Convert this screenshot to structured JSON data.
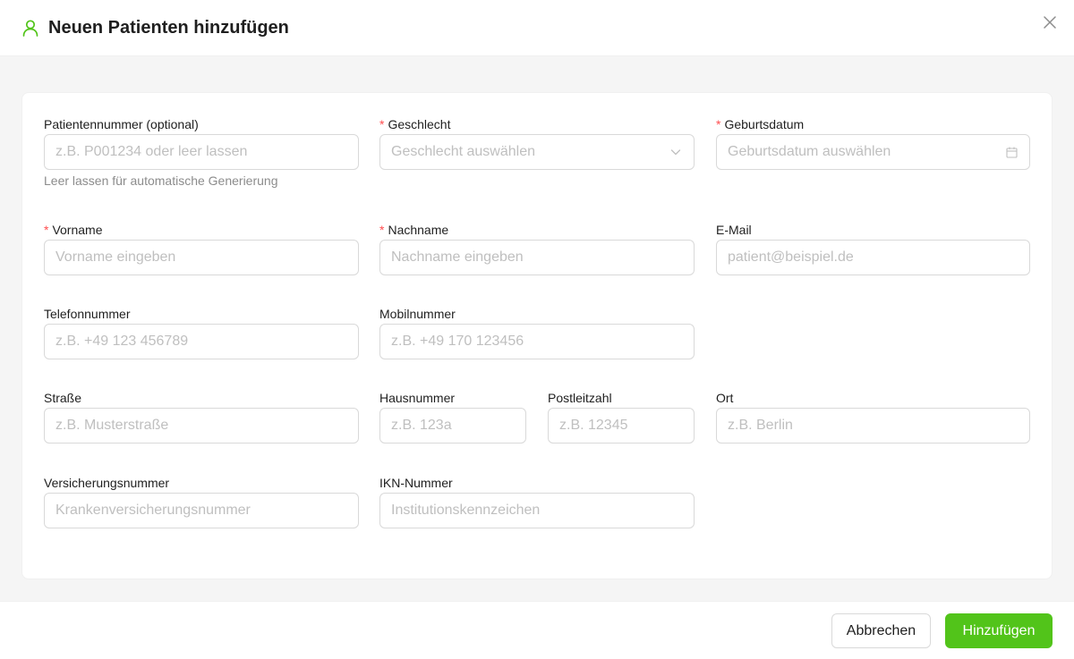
{
  "header": {
    "title": "Neuen Patienten hinzufügen",
    "icon": "user-icon",
    "accent_color": "#52c41a"
  },
  "form": {
    "patient_number": {
      "label": "Patientennummer (optional)",
      "placeholder": "z.B. P001234 oder leer lassen",
      "help": "Leer lassen für automatische Generierung"
    },
    "gender": {
      "label": "Geschlecht",
      "required": "*",
      "placeholder": "Geschlecht auswählen"
    },
    "birthdate": {
      "label": "Geburtsdatum",
      "required": "*",
      "placeholder": "Geburtsdatum auswählen"
    },
    "first_name": {
      "label": "Vorname",
      "required": "*",
      "placeholder": "Vorname eingeben"
    },
    "last_name": {
      "label": "Nachname",
      "required": "*",
      "placeholder": "Nachname eingeben"
    },
    "email": {
      "label": "E-Mail",
      "placeholder": "patient@beispiel.de"
    },
    "phone": {
      "label": "Telefonnummer",
      "placeholder": "z.B. +49 123 456789"
    },
    "mobile": {
      "label": "Mobilnummer",
      "placeholder": "z.B. +49 170 123456"
    },
    "street": {
      "label": "Straße",
      "placeholder": "z.B. Musterstraße"
    },
    "house_number": {
      "label": "Hausnummer",
      "placeholder": "z.B. 123a"
    },
    "postal_code": {
      "label": "Postleitzahl",
      "placeholder": "z.B. 12345"
    },
    "city": {
      "label": "Ort",
      "placeholder": "z.B. Berlin"
    },
    "insurance_number": {
      "label": "Versicherungsnummer",
      "placeholder": "Krankenversicherungsnummer"
    },
    "ikn_number": {
      "label": "IKN-Nummer",
      "placeholder": "Institutionskennzeichen"
    }
  },
  "footer": {
    "cancel_label": "Abbrechen",
    "submit_label": "Hinzufügen"
  }
}
